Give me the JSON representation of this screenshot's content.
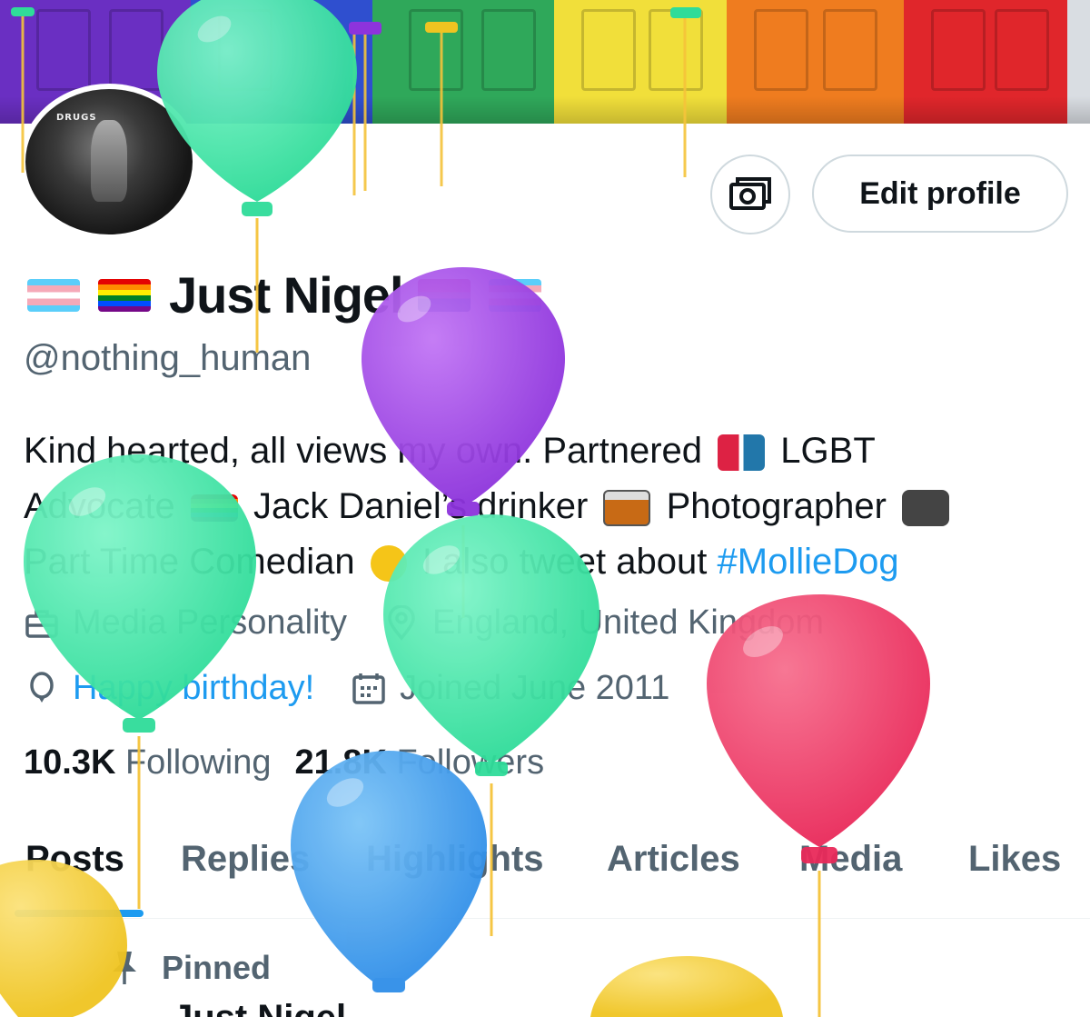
{
  "profile": {
    "display_name": "Just Nigel",
    "handle": "@nothing_human",
    "bio": {
      "line1_a": "Kind hearted, all views my own. Partnered",
      "line1_b": "LGBT",
      "line2_a": "Advocate",
      "line2_b": "Jack Daniel’s drinker",
      "line2_c": "Photographer",
      "line3_a": "Part Time Comedian",
      "line3_b": "I also tweet about",
      "hashtag": "#MollieDog"
    },
    "category": "Media Personality",
    "location": "England, United Kingdom",
    "birthday": "Happy birthday!",
    "joined": "Joined June 2011",
    "following_count": "10.3K",
    "following_label": "Following",
    "followers_count": "21.8K",
    "followers_label": "Followers",
    "avatar_sign_text": "DRUGS"
  },
  "buttons": {
    "edit_profile": "Edit profile"
  },
  "tabs": [
    {
      "label": "Posts",
      "active": true
    },
    {
      "label": "Replies"
    },
    {
      "label": "Highlights"
    },
    {
      "label": "Articles"
    },
    {
      "label": "Media"
    },
    {
      "label": "Likes"
    }
  ],
  "pinned": {
    "label": "Pinned",
    "post_author": "Just Nigel"
  },
  "colors": {
    "accent": "#1d9bf0",
    "text_primary": "#0f1419",
    "text_secondary": "#536471",
    "border": "#cfd9de",
    "balloon_green": "#3ee6a3",
    "balloon_purple": "#9b3fe0",
    "balloon_blue": "#3a9df0",
    "balloon_red": "#ee3c6a",
    "balloon_yellow": "#f3cc2a"
  },
  "icons": {
    "banner_camera": "camera-add-icon",
    "category": "briefcase-icon",
    "location": "location-pin-icon",
    "birthday": "balloon-icon",
    "joined": "calendar-icon",
    "pinned": "pin-icon"
  }
}
